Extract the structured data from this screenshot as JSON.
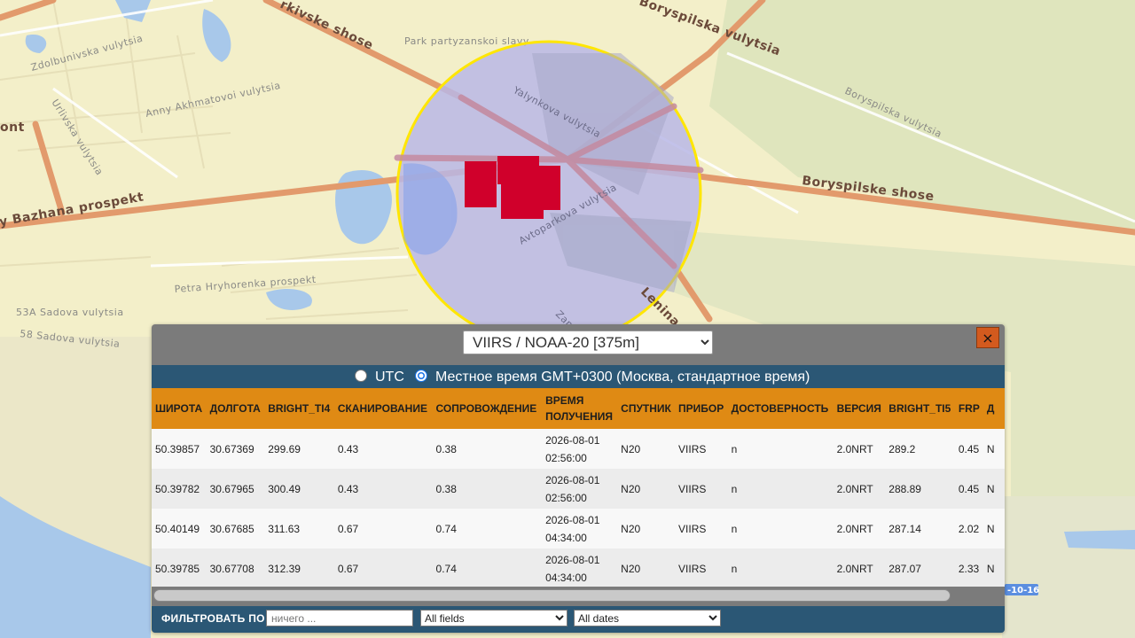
{
  "map": {
    "labels": [
      {
        "text": "Park partyzanskoi slavy",
        "kind": "minor"
      },
      {
        "text": "Zdolbunivska vulytsia",
        "kind": "minor"
      },
      {
        "text": "Anny Akhmatovoi vulytsia",
        "kind": "minor"
      },
      {
        "text": "Urlivska vulytsia",
        "kind": "minor"
      },
      {
        "text": "Petra Hryhorenka prospekt",
        "kind": "minor"
      },
      {
        "text": "53A Sadova vulytsia",
        "kind": "minor"
      },
      {
        "text": "58 Sadova vulytsia",
        "kind": "minor"
      },
      {
        "text": "Yalynkova vulytsia",
        "kind": "minor"
      },
      {
        "text": "Avtoparkova vulytsia",
        "kind": "minor"
      },
      {
        "text": "Boryspilska vulytsia",
        "kind": "minor"
      },
      {
        "text": "Boryspilske shose",
        "kind": "major"
      },
      {
        "text": "y Bazhana prospekt",
        "kind": "major"
      },
      {
        "text": "rkivske shose",
        "kind": "major"
      },
      {
        "text": "Boryspilska vulytsia",
        "kind": "major"
      },
      {
        "text": "Lenina v",
        "kind": "major"
      },
      {
        "text": "Zap",
        "kind": "minor"
      },
      {
        "text": "ont",
        "kind": "major"
      },
      {
        "text": "-10-16",
        "kind": "highway"
      }
    ],
    "colors": {
      "land": "#f3efc9",
      "green": "#dfe5bd",
      "water": "#a8c8ea",
      "highway": "#e29a6c",
      "circle_fill": "#b9b7e6",
      "circle_border": "#ffe600",
      "hotspot": "#d0002b"
    }
  },
  "panel": {
    "sensor_selected": "VIIRS / NOAA-20 [375m]",
    "close_icon": "×",
    "tz": {
      "utc_label": "UTC",
      "local_label": "Местное время GMT+0300 (Москва, стандартное время)",
      "selected": "local"
    },
    "table": {
      "columns": [
        "ШИРОТА",
        "ДОЛГОТА",
        "BRIGHT_TI4",
        "СКАНИРОВАНИЕ",
        "СОПРОВОЖДЕНИЕ",
        "ВРЕМЯ\nПОЛУЧЕНИЯ",
        "СПУТНИК",
        "ПРИБОР",
        "ДОСТОВЕРНОСТЬ",
        "ВЕРСИЯ",
        "BRIGHT_TI5",
        "FRP",
        "Д"
      ],
      "rows": [
        [
          "50.39857",
          "30.67369",
          "299.69",
          "0.43",
          "0.38",
          "2026-08-01\n02:56:00",
          "N20",
          "VIIRS",
          "n",
          "2.0NRT",
          "289.2",
          "0.45",
          "N"
        ],
        [
          "50.39782",
          "30.67965",
          "300.49",
          "0.43",
          "0.38",
          "2026-08-01\n02:56:00",
          "N20",
          "VIIRS",
          "n",
          "2.0NRT",
          "288.89",
          "0.45",
          "N"
        ],
        [
          "50.40149",
          "30.67685",
          "311.63",
          "0.67",
          "0.74",
          "2026-08-01\n04:34:00",
          "N20",
          "VIIRS",
          "n",
          "2.0NRT",
          "287.14",
          "2.02",
          "N"
        ],
        [
          "50.39785",
          "30.67708",
          "312.39",
          "0.67",
          "0.74",
          "2026-08-01\n04:34:00",
          "N20",
          "VIIRS",
          "n",
          "2.0NRT",
          "287.07",
          "2.33",
          "N"
        ]
      ]
    },
    "filter": {
      "label": "ФИЛЬТРОВАТЬ ПО",
      "placeholder": "ничего ...",
      "fields_selected": "All fields",
      "dates_selected": "All dates"
    }
  }
}
